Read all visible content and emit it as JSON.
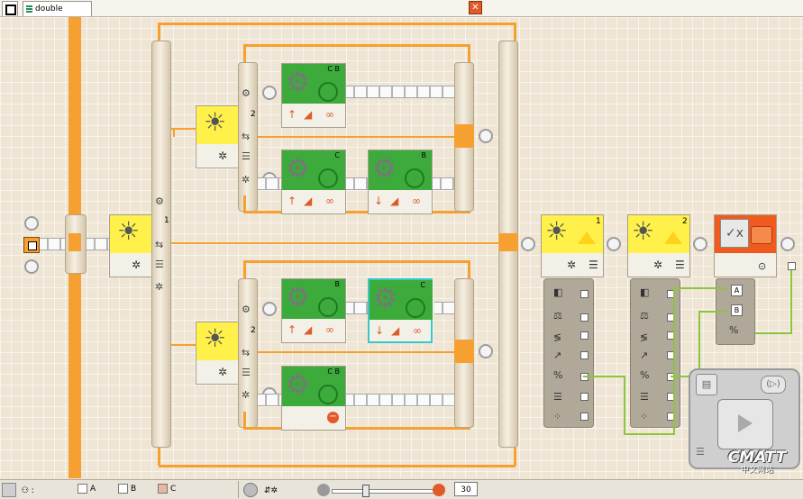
{
  "tabs": [
    {
      "label": "double"
    }
  ],
  "loop_numbers": [
    "1",
    "2",
    "2",
    "1",
    "2"
  ],
  "motors": [
    {
      "port": "C B"
    },
    {
      "port": "C"
    },
    {
      "port": "B"
    },
    {
      "port": "B"
    },
    {
      "port": "C"
    },
    {
      "port": "C B"
    }
  ],
  "math_inputs": [
    "A",
    "B"
  ],
  "statusbar": {
    "ports": [
      {
        "label": "A"
      },
      {
        "label": "B"
      },
      {
        "label": "C"
      }
    ],
    "value": "30"
  },
  "watermark": {
    "line1": "CMATT",
    "line2": "中文网站"
  },
  "colors": {
    "accent": "#f6a030",
    "motor_green": "#3cab3c",
    "sensor_yellow": "#fff04a",
    "math_orange": "#ef5a1f"
  }
}
